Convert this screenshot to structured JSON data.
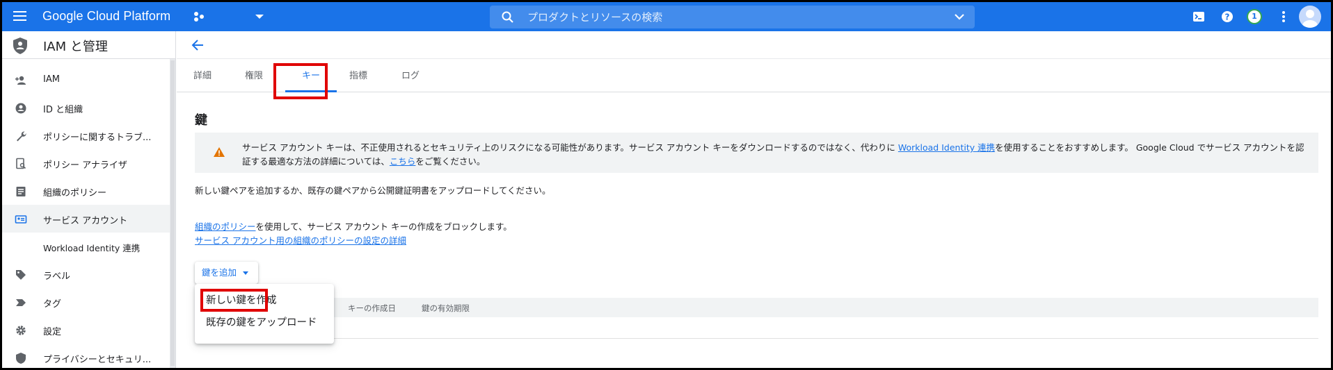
{
  "topbar": {
    "brand": "Google Cloud Platform",
    "search_placeholder": "プロダクトとリソースの検索",
    "notification_count": "1"
  },
  "sidebar": {
    "title": "IAM と管理",
    "items": [
      {
        "label": "IAM",
        "icon": "person-add-icon"
      },
      {
        "label": "ID と組織",
        "icon": "account-circle-icon"
      },
      {
        "label": "ポリシーに関するトラブ...",
        "icon": "wrench-icon"
      },
      {
        "label": "ポリシー アナライザ",
        "icon": "document-search-icon"
      },
      {
        "label": "組織のポリシー",
        "icon": "list-document-icon"
      },
      {
        "label": "サービス アカウント",
        "icon": "service-account-icon"
      },
      {
        "label": "Workload Identity 連携",
        "icon": ""
      },
      {
        "label": "ラベル",
        "icon": "label-icon"
      },
      {
        "label": "タグ",
        "icon": "tag-icon"
      },
      {
        "label": "設定",
        "icon": "gear-icon"
      },
      {
        "label": "プライバシーとセキュリ...",
        "icon": "shield-icon"
      }
    ],
    "active_index": 5
  },
  "tabs": [
    "詳細",
    "権限",
    "キー",
    "指標",
    "ログ"
  ],
  "active_tab": 2,
  "page_title": "鍵",
  "warning": {
    "text_1": "サービス アカウント キーは、不正使用されるとセキュリティ上のリスクになる可能性があります。サービス アカウント キーをダウンロードするのではなく、代わりに ",
    "link_1": "Workload Identity 連携",
    "text_2": "を使用することをおすすめします。 Google Cloud でサービス アカウントを認証する最適な方法の詳細については、",
    "link_2": "こちら",
    "text_3": "をご覧ください。"
  },
  "description": "新しい鍵ペアを追加するか、既存の鍵ペアから公開鍵証明書をアップロードしてください。",
  "policy": {
    "link": "組織のポリシー",
    "text": "を使用して、サービス アカウント キーの作成をブロックします。",
    "details_link": "サービス アカウント用の組織のポリシーの設定の詳細"
  },
  "add_key_button": "鍵を追加",
  "menu": {
    "items": [
      "新しい鍵を作成",
      "既存の鍵をアップロード"
    ]
  },
  "table": {
    "headers": [
      "キーの作成日",
      "鍵の有効期限"
    ]
  },
  "colors": {
    "brand_blue": "#1a73e8",
    "highlight_red": "#e00000",
    "warning_orange": "#e37400"
  }
}
